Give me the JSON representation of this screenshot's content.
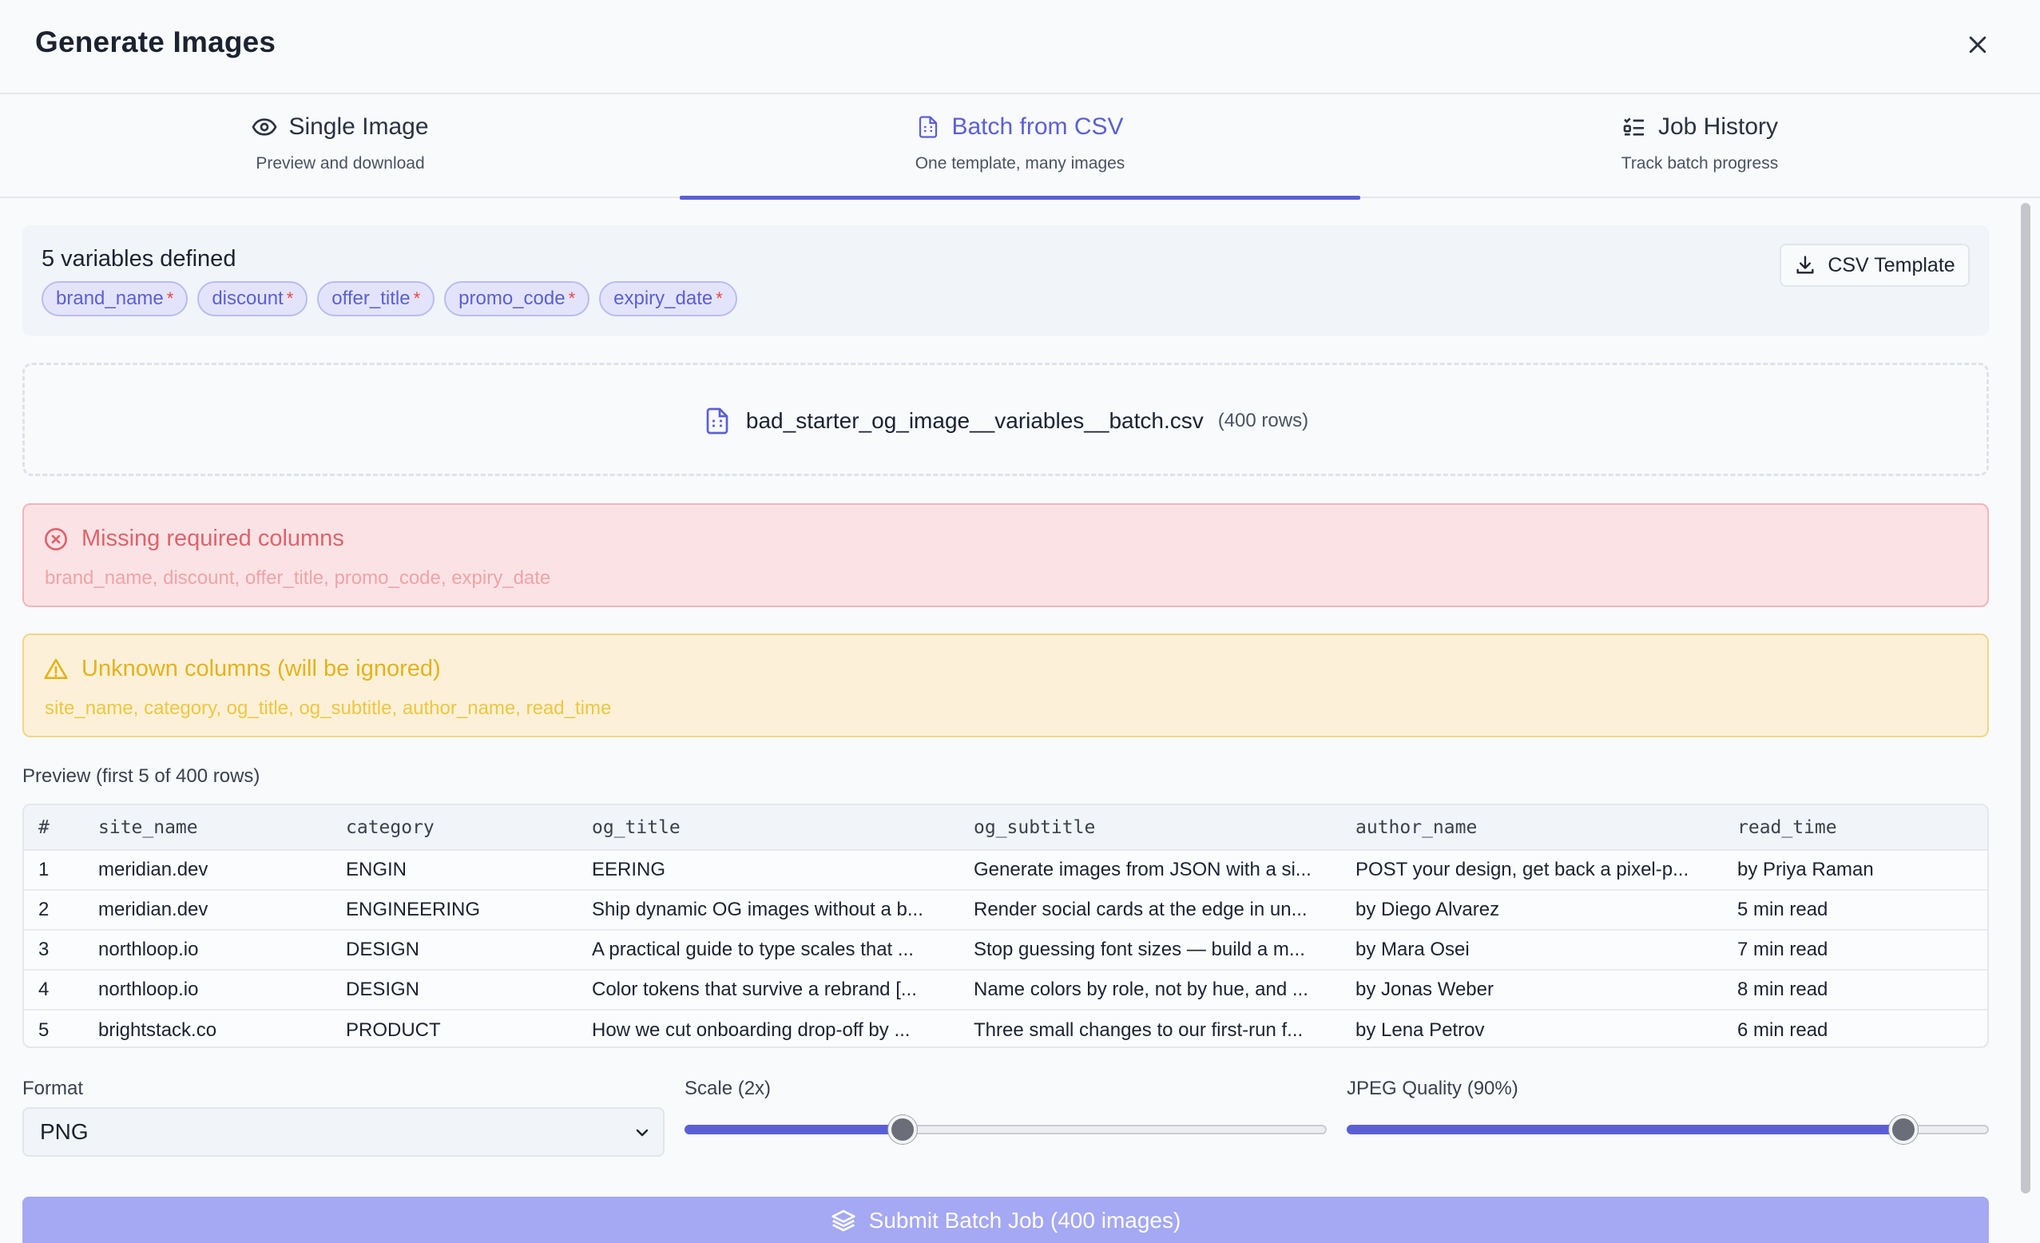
{
  "modal": {
    "title": "Generate Images"
  },
  "tabs": [
    {
      "label": "Single Image",
      "sub": "Preview and download",
      "icon": "eye-icon"
    },
    {
      "label": "Batch from CSV",
      "sub": "One template, many images",
      "icon": "file-spreadsheet-icon"
    },
    {
      "label": "Job History",
      "sub": "Track batch progress",
      "icon": "list-checks-icon"
    }
  ],
  "variables": {
    "title": "5 variables defined",
    "items": [
      "brand_name",
      "discount",
      "offer_title",
      "promo_code",
      "expiry_date"
    ],
    "required_marker": "*"
  },
  "csv_template_button": {
    "label": "CSV Template",
    "icon": "download-icon"
  },
  "upload": {
    "file_name": "bad_starter_og_image__variables__batch.csv",
    "rows": "(400 rows)"
  },
  "alerts": {
    "error": {
      "title": "Missing required columns",
      "body": "brand_name, discount, offer_title, promo_code, expiry_date"
    },
    "warning": {
      "title": "Unknown columns (will be ignored)",
      "body": "site_name, category, og_title, og_subtitle, author_name, read_time"
    }
  },
  "preview": {
    "label": "Preview (first 5 of 400 rows)",
    "columns": [
      "#",
      "site_name",
      "category",
      "og_title",
      "og_subtitle",
      "author_name",
      "read_time"
    ],
    "rows": [
      [
        "1",
        "meridian.dev",
        "ENGIN",
        "EERING",
        "Generate images from JSON with a si...",
        "POST your design, get back a pixel-p...",
        "by Priya Raman"
      ],
      [
        "2",
        "meridian.dev",
        "ENGINEERING",
        "Ship dynamic OG images without a b...",
        "Render social cards at the edge in un...",
        "by Diego Alvarez",
        "5 min read"
      ],
      [
        "3",
        "northloop.io",
        "DESIGN",
        "A practical guide to type scales that ...",
        "Stop guessing font sizes — build a m...",
        "by Mara Osei",
        "7 min read"
      ],
      [
        "4",
        "northloop.io",
        "DESIGN",
        "Color tokens that survive a rebrand [...",
        "Name colors by role, not by hue, and ...",
        "by Jonas Weber",
        "8 min read"
      ],
      [
        "5",
        "brightstack.co",
        "PRODUCT",
        "How we cut onboarding drop-off by ...",
        "Three small changes to our first-run f...",
        "by Lena Petrov",
        "6 min read"
      ]
    ]
  },
  "controls": {
    "format": {
      "label": "Format",
      "value": "PNG"
    },
    "scale": {
      "label": "Scale (2x)",
      "fraction": 0.34
    },
    "quality": {
      "label": "JPEG Quality (90%)",
      "fraction": 0.867
    }
  },
  "submit": {
    "label": "Submit Batch Job (400 images)",
    "icon": "layers-icon"
  },
  "colors": {
    "accent": "#5b5fd6",
    "error": "#e0626a",
    "warning": "#e6b21a"
  }
}
